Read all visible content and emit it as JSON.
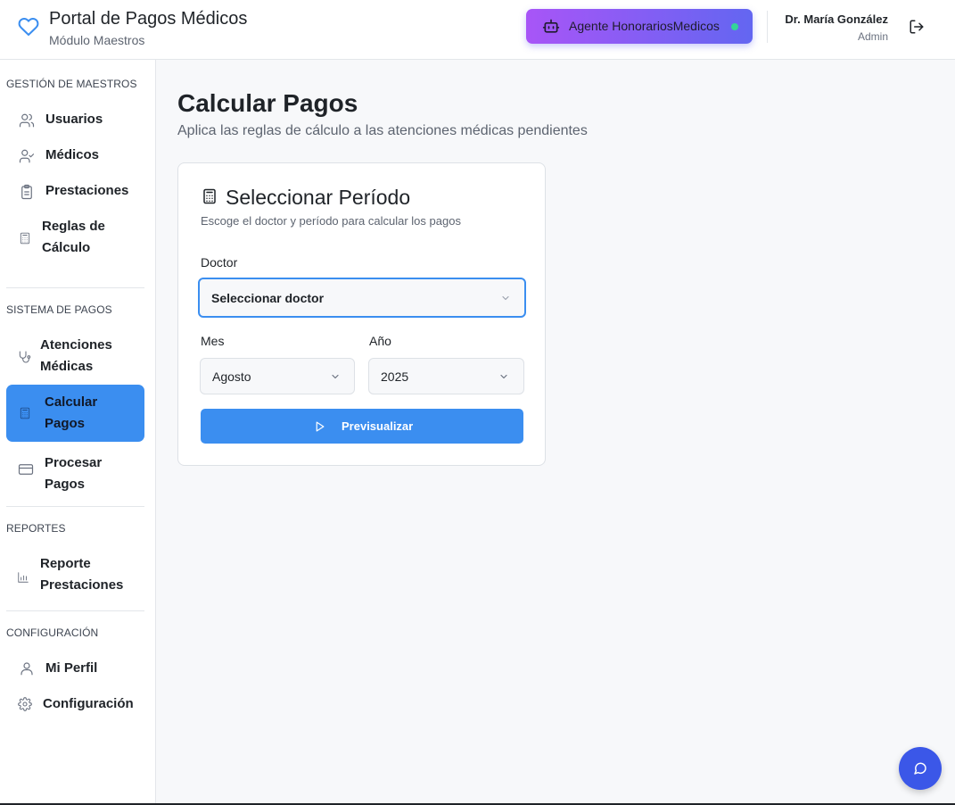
{
  "header": {
    "title": "Portal de Pagos Médicos",
    "subtitle": "Módulo Maestros",
    "agent_button": "Agente HonorariosMedicos",
    "user_name": "Dr. María González",
    "user_role": "Admin"
  },
  "sidebar": {
    "sections": [
      {
        "title": "GESTIÓN DE MAESTROS",
        "items": [
          {
            "label": "Usuarios",
            "icon": "users-icon"
          },
          {
            "label": "Médicos",
            "icon": "user-check-icon"
          },
          {
            "label": "Prestaciones",
            "icon": "clipboard-icon"
          },
          {
            "label1": "Reglas de",
            "label2": "Cálculo",
            "icon": "calculator-icon"
          }
        ]
      },
      {
        "title": "SISTEMA DE PAGOS",
        "items": [
          {
            "label1": "Atenciones",
            "label2": "Médicas",
            "icon": "stethoscope-icon"
          },
          {
            "label1": "Calcular",
            "label2": "Pagos",
            "icon": "calculator-icon",
            "active": true
          },
          {
            "label1": "Procesar",
            "label2": "Pagos",
            "icon": "credit-card-icon"
          }
        ]
      },
      {
        "title": "REPORTES",
        "items": [
          {
            "label1": "Reporte",
            "label2": "Prestaciones",
            "icon": "bar-chart-icon"
          }
        ]
      },
      {
        "title": "CONFIGURACIÓN",
        "items": [
          {
            "label": "Mi Perfil",
            "icon": "user-icon"
          },
          {
            "label": "Configuración",
            "icon": "gear-icon"
          }
        ]
      }
    ]
  },
  "main": {
    "title": "Calcular Pagos",
    "subtitle": "Aplica las reglas de cálculo a las atenciones médicas pendientes",
    "card": {
      "title": "Seleccionar Período",
      "description": "Escoge el doctor y período para calcular los pagos",
      "doctor_label": "Doctor",
      "doctor_value": "Seleccionar doctor",
      "month_label": "Mes",
      "month_value": "Agosto",
      "year_label": "Año",
      "year_value": "2025",
      "preview_button": "Previsualizar"
    }
  },
  "colors": {
    "accent": "#3b8ef0",
    "agent_gradient_start": "#a855f7",
    "agent_gradient_end": "#6366f1",
    "status_online": "#34d399",
    "fab": "#3b57e8"
  }
}
